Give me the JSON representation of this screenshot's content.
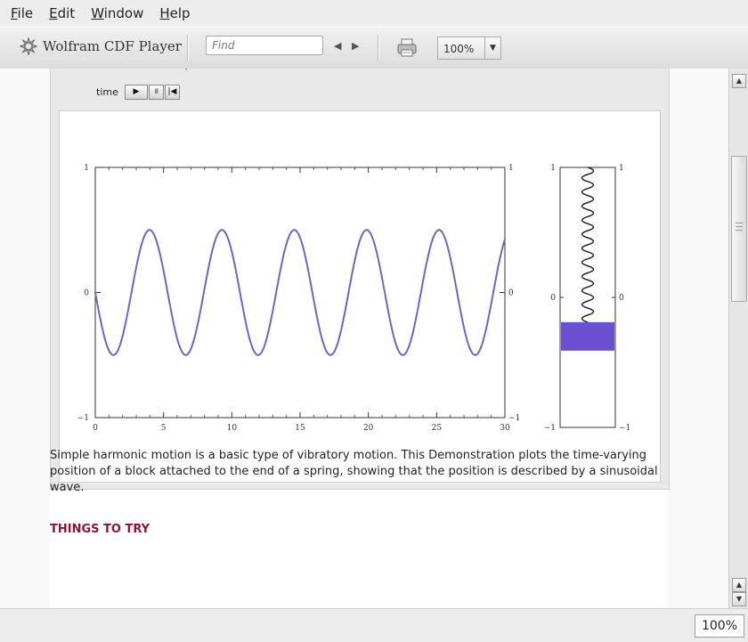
{
  "menu": {
    "items": [
      {
        "first": "F",
        "rest": "ile"
      },
      {
        "first": "E",
        "rest": "dit"
      },
      {
        "first": "W",
        "rest": "indow"
      },
      {
        "first": "H",
        "rest": "elp"
      }
    ]
  },
  "toolbar": {
    "app_name": "Wolfram CDF Player",
    "find_placeholder": "Find",
    "zoom_value": "100%",
    "icons": [
      "wolfram-logo-icon",
      "prev-arrow-icon",
      "next-arrow-icon",
      "print-icon",
      "chevron-down-icon"
    ]
  },
  "controls": {
    "time_label": "time",
    "play_glyph": "▶",
    "pause_glyph": "॥",
    "reset_glyph": "|◀"
  },
  "chart_data": [
    {
      "type": "line",
      "title": "",
      "xlabel": "",
      "ylabel": "",
      "x_ticks": [
        "0",
        "5",
        "10",
        "15",
        "20",
        "25",
        "30"
      ],
      "y_ticks": [
        "−1",
        "0",
        "1"
      ],
      "xlim": [
        0,
        30
      ],
      "ylim": [
        -1,
        1
      ],
      "series": [
        {
          "function": "y = -0.5 * sin(2π x / 5.3)",
          "x_range": [
            0,
            30
          ],
          "amplitude": 0.5,
          "period": 5.3,
          "color": "#6b67c2"
        }
      ]
    },
    {
      "type": "other",
      "description_none": "",
      "y_ticks": [
        "−1",
        "0",
        "1"
      ],
      "ylim": [
        -1,
        1
      ],
      "spring_top": 1,
      "block_position": -0.3,
      "spring_coils": 11,
      "block_color": "#6a4fd0"
    }
  ],
  "description": "Simple harmonic motion is a basic type of vibratory motion. This Demonstration plots the time-varying position of a block attached to the end of a spring, showing that the position is described by a sinusoidal wave.",
  "section_heading": "THINGS TO TRY",
  "colors": {
    "curve": "#6b67c2",
    "block": "#6a4fd0",
    "heading": "#8a1538"
  },
  "status": {
    "zoom": "100%"
  }
}
